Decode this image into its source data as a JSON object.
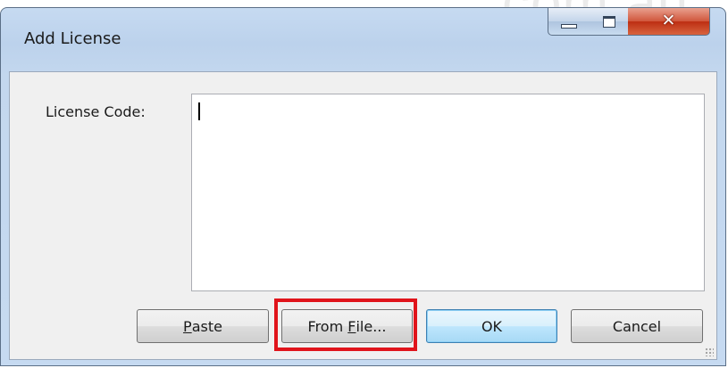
{
  "watermark": {
    "text": "com.au"
  },
  "window": {
    "title": "Add License",
    "controls": {
      "minimize": "minimize",
      "maximize": "maximize",
      "close": "close"
    }
  },
  "form": {
    "license_label": "License Code:",
    "license_value": ""
  },
  "buttons": {
    "paste": {
      "label": "Paste",
      "mnemonic": "P",
      "rest": "aste"
    },
    "from_file": {
      "label": "From File...",
      "prefix": "From ",
      "mnemonic": "F",
      "rest": "ile..."
    },
    "ok": {
      "label": "OK"
    },
    "cancel": {
      "label": "Cancel"
    }
  },
  "colors": {
    "highlight": "#e0141b",
    "title_bar": "#c6daf1",
    "close_button": "#c4401e",
    "default_button_border": "#3c7fb1"
  }
}
